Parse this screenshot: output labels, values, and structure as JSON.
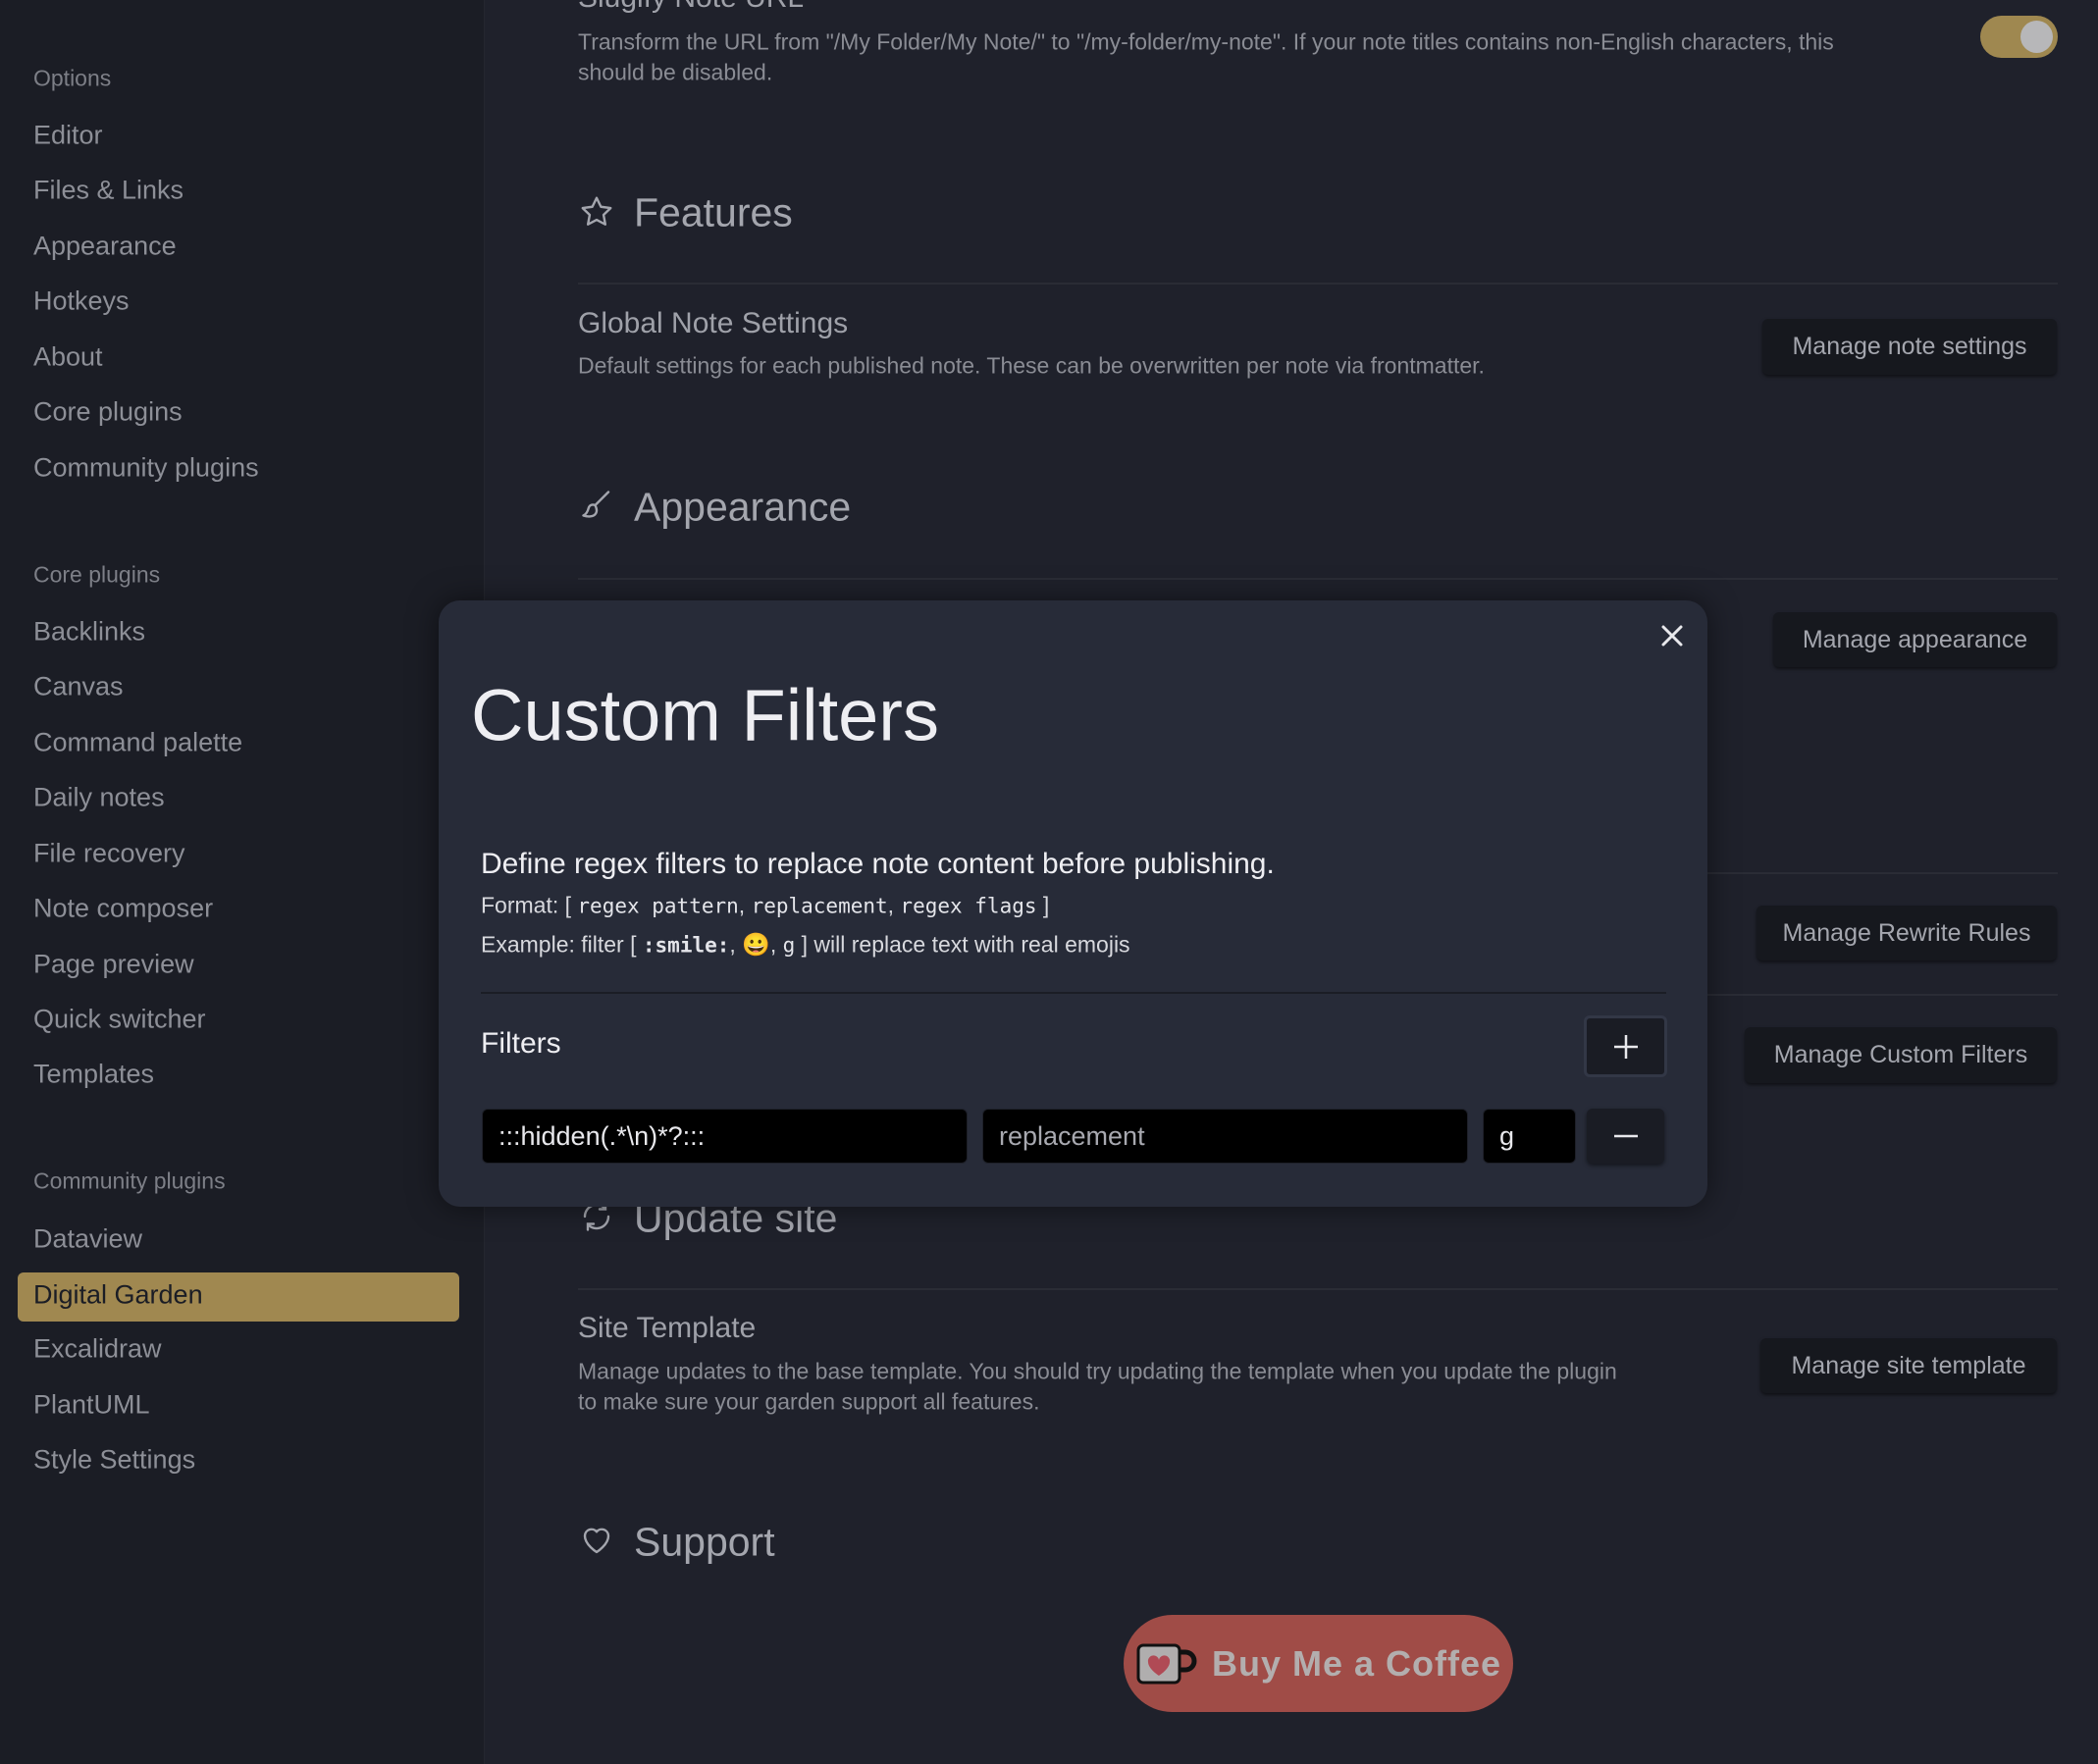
{
  "sidebar": {
    "options_header": "Options",
    "options": [
      "Editor",
      "Files & Links",
      "Appearance",
      "Hotkeys",
      "About",
      "Core plugins",
      "Community plugins"
    ],
    "core_header": "Core plugins",
    "core": [
      "Backlinks",
      "Canvas",
      "Command palette",
      "Daily notes",
      "File recovery",
      "Note composer",
      "Page preview",
      "Quick switcher",
      "Templates"
    ],
    "community_header": "Community plugins",
    "community": [
      "Dataview",
      "Digital Garden",
      "Excalidraw",
      "PlantUML",
      "Style Settings"
    ],
    "active": "Digital Garden"
  },
  "main": {
    "slugify": {
      "title": "Slugify Note URL",
      "desc1": "Transform the URL from \"/My Folder/My Note/\" to \"/my-folder/my-note\". If your note titles contains non-English characters, this",
      "desc2": "should be disabled.",
      "enabled": true
    },
    "features": {
      "heading": "Features",
      "icon": "star-icon"
    },
    "global": {
      "title": "Global Note Settings",
      "desc": "Default settings for each published note. These can be overwritten per note via frontmatter.",
      "button": "Manage note settings"
    },
    "appearance": {
      "heading": "Appearance",
      "icon": "paintbrush-icon",
      "button": "Manage appearance"
    },
    "rewrite": {
      "button": "Manage Rewrite Rules"
    },
    "filters": {
      "button": "Manage Custom Filters"
    },
    "update": {
      "heading": "Update site",
      "icon": "refresh-icon"
    },
    "template": {
      "title": "Site Template",
      "desc1": "Manage updates to the base template. You should try updating the template when you update the plugin",
      "desc2": "to make sure your garden support all features.",
      "button": "Manage site template"
    },
    "support": {
      "heading": "Support",
      "icon": "heart-icon",
      "coffee": "Buy Me a Coffee"
    }
  },
  "modal": {
    "title": "Custom Filters",
    "intro": "Define regex filters to replace note content before publishing.",
    "format_label": "Format: [",
    "format_pattern": "regex pattern",
    "format_replacement": "replacement",
    "format_flags": "regex flags",
    "format_end": "]",
    "example_label": "Example: filter [",
    "example_pattern": ":smile:",
    "example_emoji": "😀",
    "example_flags": "g",
    "example_end": "] will replace text with real emojis",
    "sep": ",",
    "filters_label": "Filters",
    "rows": [
      {
        "pattern": ":::hidden(.*\\n)*?:::",
        "replacement_placeholder": "replacement",
        "flags": "g"
      }
    ]
  },
  "colors": {
    "accent": "#a08850",
    "coffee": "#a04c47",
    "modal_bg": "#272b38"
  }
}
